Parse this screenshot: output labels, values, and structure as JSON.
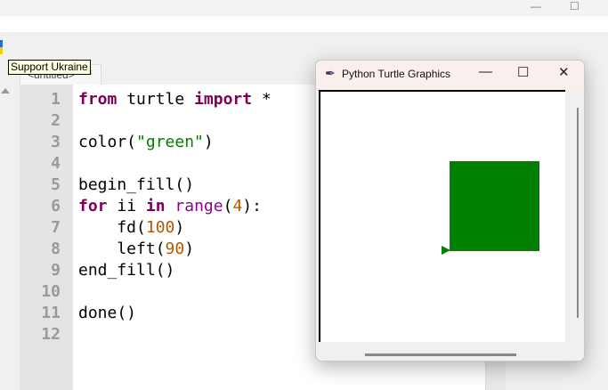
{
  "tooltip": "Support Ukraine",
  "tab": {
    "label": "<untitled>",
    "close": "×"
  },
  "editor": {
    "line_numbers": [
      "1",
      "2",
      "3",
      "4",
      "5",
      "6",
      "7",
      "8",
      "9",
      "10",
      "11",
      "12"
    ],
    "lines": [
      [
        {
          "t": "from",
          "c": "kw"
        },
        {
          "t": " turtle "
        },
        {
          "t": "import",
          "c": "kw"
        },
        {
          "t": " *"
        }
      ],
      [],
      [
        {
          "t": "color("
        },
        {
          "t": "\"green\"",
          "c": "st"
        },
        {
          "t": ")"
        }
      ],
      [],
      [
        {
          "t": "begin_fill()"
        }
      ],
      [
        {
          "t": "for",
          "c": "kw"
        },
        {
          "t": " ii "
        },
        {
          "t": "in",
          "c": "kw"
        },
        {
          "t": " "
        },
        {
          "t": "range",
          "c": "bi"
        },
        {
          "t": "("
        },
        {
          "t": "4",
          "c": "nu"
        },
        {
          "t": "):"
        }
      ],
      [
        {
          "t": "    fd("
        },
        {
          "t": "100",
          "c": "nu"
        },
        {
          "t": ")"
        }
      ],
      [
        {
          "t": "    left("
        },
        {
          "t": "90",
          "c": "nu"
        },
        {
          "t": ")"
        }
      ],
      [
        {
          "t": "end_fill()"
        }
      ],
      [],
      [
        {
          "t": "done()"
        }
      ],
      []
    ]
  },
  "turtle_window": {
    "title": "Python Turtle Graphics",
    "minimize": "—",
    "maximize": "☐",
    "close": "✕",
    "fill_color": "#008000"
  },
  "window_controls": {
    "minimize": "—",
    "maximize": "☐"
  }
}
